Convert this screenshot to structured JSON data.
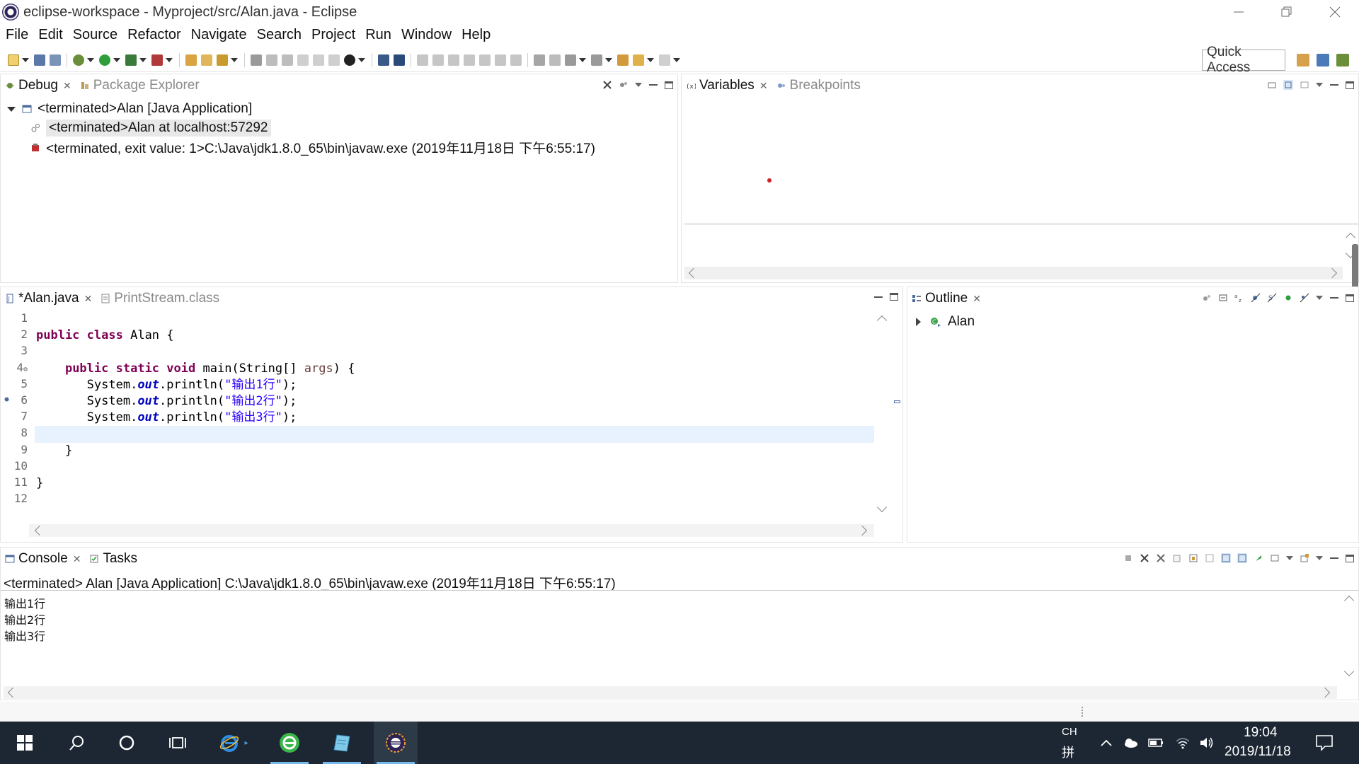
{
  "window": {
    "title": "eclipse-workspace - Myproject/src/Alan.java - Eclipse"
  },
  "menu": [
    "File",
    "Edit",
    "Source",
    "Refactor",
    "Navigate",
    "Search",
    "Project",
    "Run",
    "Window",
    "Help"
  ],
  "toolbar": {
    "quick_access": "Quick Access"
  },
  "debug_panel": {
    "tabs": [
      {
        "label": "Debug",
        "icon": "debug-icon"
      },
      {
        "label": "Package Explorer",
        "icon": "package-explorer-icon"
      }
    ],
    "tree": [
      {
        "text": "<terminated>Alan [Java Application]",
        "icon": "java-application-icon",
        "expanded": true
      },
      {
        "text": "<terminated>Alan at localhost:57292",
        "icon": "debug-target-icon",
        "selected": true
      },
      {
        "text": "<terminated, exit value: 1>C:\\Java\\jdk1.8.0_65\\bin\\javaw.exe (2019年11月18日 下午6:55:17)",
        "icon": "process-icon"
      }
    ]
  },
  "variables_panel": {
    "tabs": [
      {
        "label": "Variables",
        "icon": "variables-icon"
      },
      {
        "label": "Breakpoints",
        "icon": "breakpoints-icon"
      }
    ]
  },
  "editor": {
    "tabs": [
      {
        "label": "*Alan.java",
        "icon": "java-file-icon"
      },
      {
        "label": "PrintStream.class",
        "icon": "class-file-icon"
      }
    ],
    "line_numbers": [
      "1",
      "2",
      "3",
      "4",
      "5",
      "6",
      "7",
      "8",
      "9",
      "10",
      "11",
      "12"
    ],
    "code": {
      "l2_kw1": "public",
      "l2_kw2": "class",
      "l2_rest": " Alan {",
      "l4_indent": "    ",
      "l4_kw1": "public",
      "l4_kw2": "static",
      "l4_kw3": "void",
      "l4_rest1": " main(String[] ",
      "l4_param": "args",
      "l4_rest2": ") {",
      "indent2": "       ",
      "sys": "System.",
      "out": "out",
      "println": ".println(",
      "s1": "\"输出1行\"",
      "s2": "\"输出2行\"",
      "s3": "\"输出3行\"",
      "end": ");",
      "l9": "    }",
      "l11": "}"
    }
  },
  "outline_panel": {
    "tabs": [
      {
        "label": "Outline",
        "icon": "outline-icon"
      }
    ],
    "items": [
      {
        "label": "Alan",
        "icon": "class-icon"
      }
    ]
  },
  "console_panel": {
    "tabs": [
      {
        "label": "Console",
        "icon": "console-icon"
      },
      {
        "label": "Tasks",
        "icon": "tasks-icon"
      }
    ],
    "header": "<terminated> Alan [Java Application] C:\\Java\\jdk1.8.0_65\\bin\\javaw.exe (2019年11月18日 下午6:55:17)",
    "output": [
      "输出1行",
      "输出2行",
      "输出3行"
    ]
  },
  "taskbar": {
    "ime_top": "CH",
    "ime_bottom": "拼",
    "time": "19:04",
    "date": "2019/11/18"
  },
  "colors": {
    "keyword": "#7f0055",
    "string": "#2a00ff",
    "field": "#0000c0",
    "current_line": "#e8f2fe",
    "taskbar": "#1c2733"
  }
}
